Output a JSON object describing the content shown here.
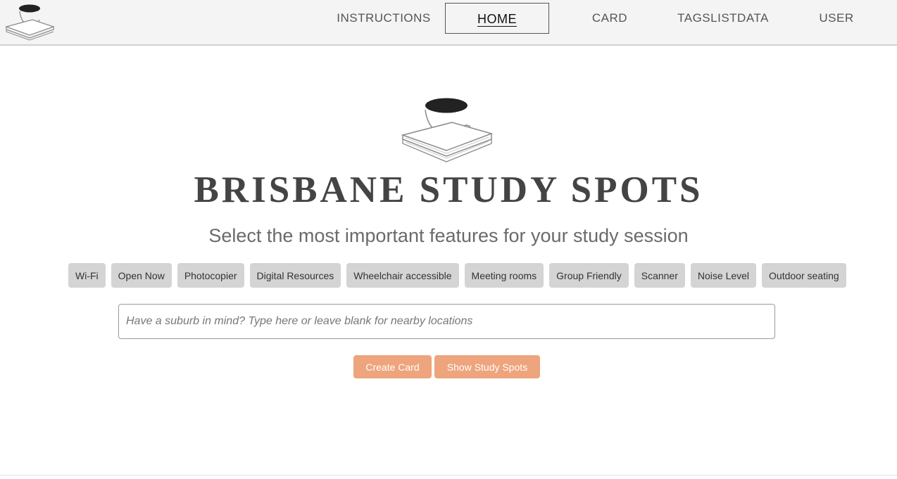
{
  "nav": {
    "items": [
      {
        "label": "INSTRUCTIONS",
        "active": false
      },
      {
        "label": "HOME",
        "active": true
      },
      {
        "label": "CARD",
        "active": false
      },
      {
        "label": "TAGSLISTDATA",
        "active": false
      },
      {
        "label": "USER",
        "active": false
      }
    ]
  },
  "hero": {
    "title": "BRISBANE STUDY SPOTS",
    "subtitle": "Select the most important features for your study session"
  },
  "features": [
    "Wi-Fi",
    "Open Now",
    "Photocopier",
    "Digital Resources",
    "Wheelchair accessible",
    "Meeting rooms",
    "Group Friendly",
    "Scanner",
    "Noise Level",
    "Outdoor seating"
  ],
  "search": {
    "value": "",
    "placeholder": "Have a suburb in mind? Type here or leave blank for nearby locations"
  },
  "actions": {
    "create_label": "Create Card",
    "show_label": "Show Study Spots"
  },
  "colors": {
    "accent": "#eea47c",
    "tag_bg": "#d4d4d4",
    "nav_bg": "#f4f4f4"
  },
  "icons": {
    "logo": "coffee-cup-on-books-logo"
  }
}
